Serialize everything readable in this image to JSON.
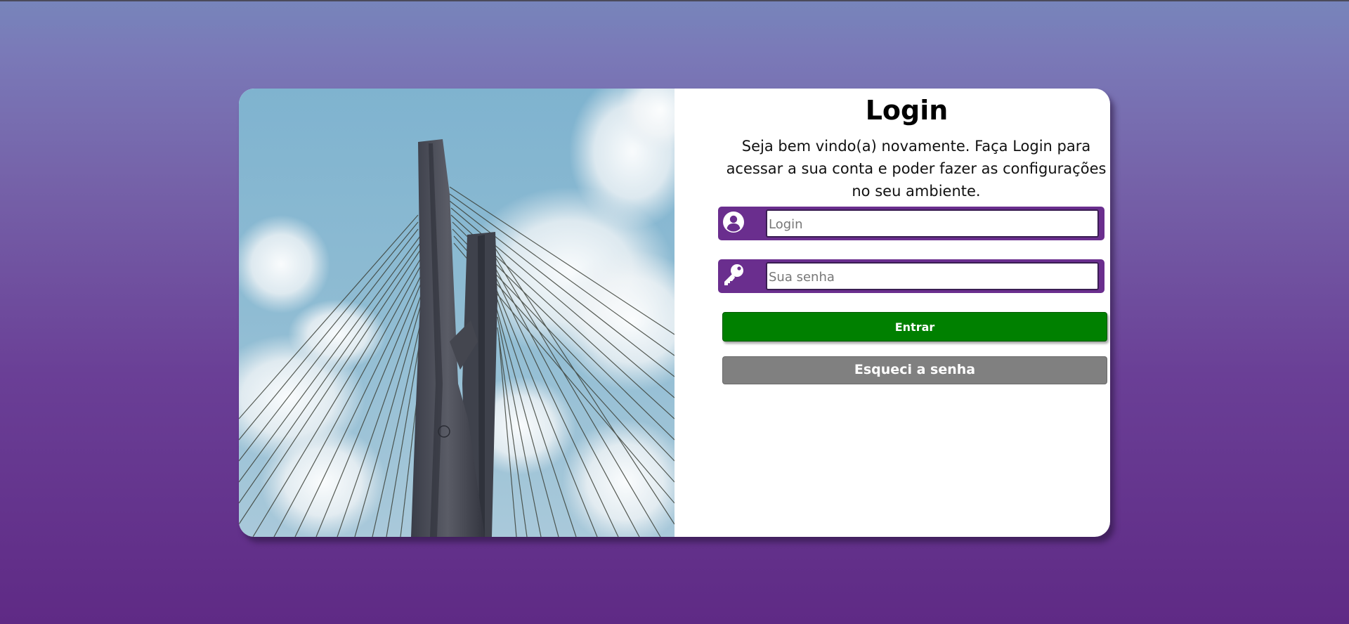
{
  "login_page": {
    "title": "Login",
    "subtitle": "Seja bem vindo(a) novamente. Faça Login para acessar a sua conta e poder fazer as configurações no seu ambiente.",
    "login_field": {
      "icon": "user-circle-icon",
      "placeholder": "Login",
      "value": ""
    },
    "password_field": {
      "icon": "key-icon",
      "placeholder": "Sua senha",
      "value": ""
    },
    "enter_button": {
      "label": "Entrar",
      "color": "#008000"
    },
    "forgot_button": {
      "label": "Esqueci a senha",
      "color": "#808080"
    }
  },
  "colors": {
    "background_top": "#7785bb",
    "background_bottom": "#5f2a85",
    "field_frame": "#6a2e8e",
    "card": "#ffffff"
  }
}
